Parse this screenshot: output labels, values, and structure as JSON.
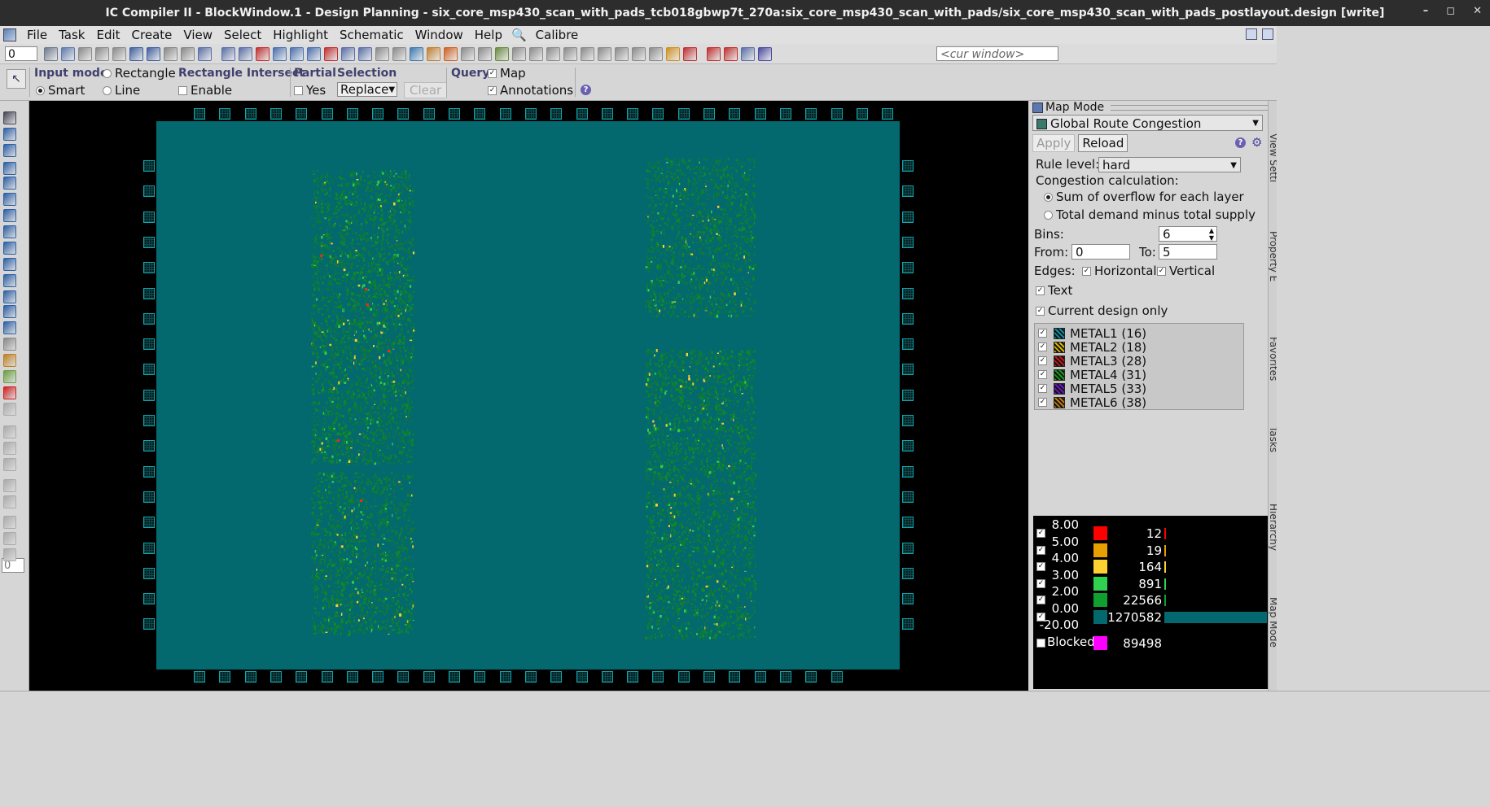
{
  "window": {
    "title": "IC Compiler II - BlockWindow.1 - Design Planning - six_core_msp430_scan_with_pads_tcb018gbwp7t_270a:six_core_msp430_scan_with_pads/six_core_msp430_scan_with_pads_postlayout.design [write]",
    "minimize": "–",
    "maximize": "◻",
    "close": "✕"
  },
  "menu": [
    "File",
    "Task",
    "Edit",
    "Create",
    "View",
    "Select",
    "Highlight",
    "Schematic",
    "Window",
    "Help",
    "Calibre"
  ],
  "toolbar": {
    "spin_value": "0",
    "cur_window_placeholder": "<cur window>"
  },
  "options": {
    "input_mode": {
      "header": "Input mode",
      "rectangle": "Rectangle",
      "smart": "Smart",
      "line": "Line",
      "selected": "Smart"
    },
    "rect_intersect": {
      "header": "Rectangle Intersect",
      "enable": "Enable",
      "checked": false
    },
    "partial": {
      "header": "Partial",
      "yes": "Yes",
      "checked": false
    },
    "selection": {
      "header": "Selection",
      "mode": "Replace",
      "clear": "Clear"
    },
    "query": {
      "header": "Query",
      "map": "Map",
      "map_checked": true,
      "annotations": "Annotations",
      "annotations_checked": true
    }
  },
  "left_tools": {
    "spin_value": "0"
  },
  "map_panel": {
    "title": "Map Mode",
    "map_type": "Global Route Congestion",
    "apply": "Apply",
    "reload": "Reload",
    "rule_level_label": "Rule level:",
    "rule_level": "hard",
    "congestion_calc_label": "Congestion calculation:",
    "calc_options": [
      "Sum of overflow for each layer",
      "Total demand minus total supply"
    ],
    "calc_selected": 0,
    "bins_label": "Bins:",
    "bins": "6",
    "from_label": "From:",
    "from": "0",
    "to_label": "To:",
    "to": "5",
    "edges_label": "Edges:",
    "horizontal": "Horizontal",
    "vertical": "Vertical",
    "text": "Text",
    "current_design_only": "Current design only",
    "layers": [
      {
        "name": "METAL1 (16)",
        "color": "#0c8fa0"
      },
      {
        "name": "METAL2 (18)",
        "color": "#d6b400"
      },
      {
        "name": "METAL3 (28)",
        "color": "#c01a1a"
      },
      {
        "name": "METAL4 (31)",
        "color": "#1a9a1a"
      },
      {
        "name": "METAL5 (33)",
        "color": "#6a1ac0"
      },
      {
        "name": "METAL6 (38)",
        "color": "#c07a10"
      }
    ]
  },
  "legend": {
    "rows": [
      {
        "level": "8.00",
        "color": "#ff0000",
        "count": "12",
        "bar_color": "#ff0000",
        "bar_frac": 0.0
      },
      {
        "level": "5.00",
        "color": "#e8a000",
        "count": "19",
        "bar_color": "#e8a000",
        "bar_frac": 0.0
      },
      {
        "level": "4.00",
        "color": "#ffd030",
        "count": "164",
        "bar_color": "#ffd030",
        "bar_frac": 0.0
      },
      {
        "level": "3.00",
        "color": "#30d050",
        "count": "891",
        "bar_color": "#30d050",
        "bar_frac": 0.0
      },
      {
        "level": "2.00",
        "color": "#10a030",
        "count": "22566",
        "bar_color": "#10a030",
        "bar_frac": 0.018
      },
      {
        "level": "0.00",
        "color": "#03696e",
        "count": "1270582",
        "bar_color": "#03696e",
        "bar_frac": 1.0
      },
      {
        "level": "-20.00",
        "color": "",
        "count": "",
        "bar_color": "",
        "bar_frac": 0.0
      }
    ],
    "blocked_label": "Blocked",
    "blocked_color": "#ff00ff",
    "blocked_count": "89498"
  },
  "side_tabs": [
    "View Setti",
    "Property E",
    "Favorites",
    "Tasks",
    "Hierarchy",
    "Map Mode"
  ]
}
